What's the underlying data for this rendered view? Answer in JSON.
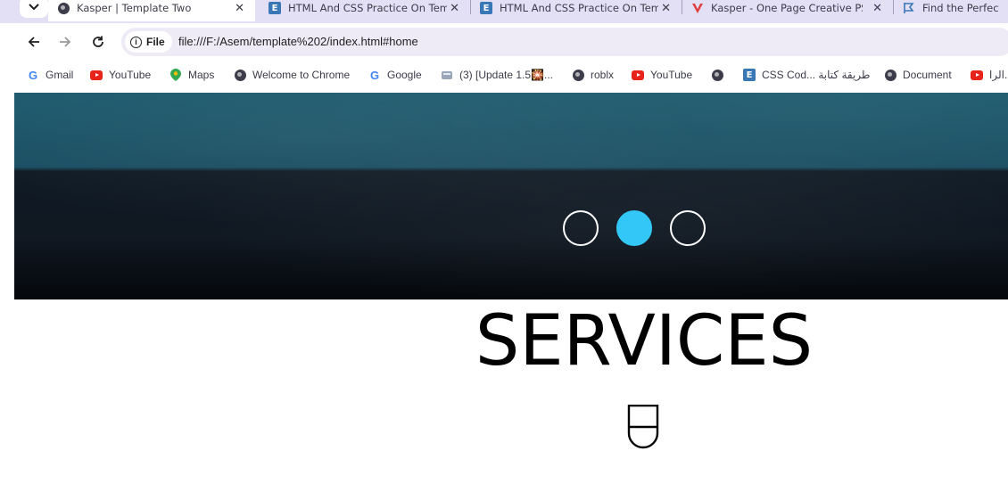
{
  "browser": {
    "tabs": [
      {
        "title": "Kasper | Template Two",
        "active": true,
        "favicon": "globe-icon"
      },
      {
        "title": "HTML And CSS Practice On Tem",
        "active": false,
        "favicon": "e-icon"
      },
      {
        "title": "HTML And CSS Practice On Tem",
        "active": false,
        "favicon": "e-icon"
      },
      {
        "title": "Kasper - One Page Creative PSD",
        "active": false,
        "favicon": "v-icon"
      },
      {
        "title": "Find the Perfect Ic",
        "active": false,
        "favicon": "flag-icon"
      }
    ],
    "close_glyph": "✕",
    "site_info_chip": "File",
    "url": "file:///F:/Asem/template%202/index.html#home",
    "bookmarks": [
      {
        "label": "Gmail",
        "icon": "google-icon"
      },
      {
        "label": "YouTube",
        "icon": "youtube-icon"
      },
      {
        "label": "Maps",
        "icon": "maps-icon"
      },
      {
        "label": "Welcome to Chrome",
        "icon": "globe-icon"
      },
      {
        "label": "Google",
        "icon": "google-icon"
      },
      {
        "label": "(3) [Update 1.5🎇...",
        "icon": "roblox-icon"
      },
      {
        "label": "roblx",
        "icon": "globe-icon"
      },
      {
        "label": "YouTube",
        "icon": "youtube-icon"
      },
      {
        "label": "",
        "icon": "globe-icon"
      },
      {
        "label": "CSS Cod... طريقة كتابة",
        "icon": "e-icon"
      },
      {
        "label": "Document",
        "icon": "globe-icon"
      },
      {
        "label": "الرا...",
        "icon": "youtube-icon"
      }
    ]
  },
  "page": {
    "slider_bullets": [
      false,
      true,
      false
    ],
    "accent_color": "#33c7f7",
    "section_title": "SERVICES",
    "section_icon": "u-shape-icon"
  }
}
